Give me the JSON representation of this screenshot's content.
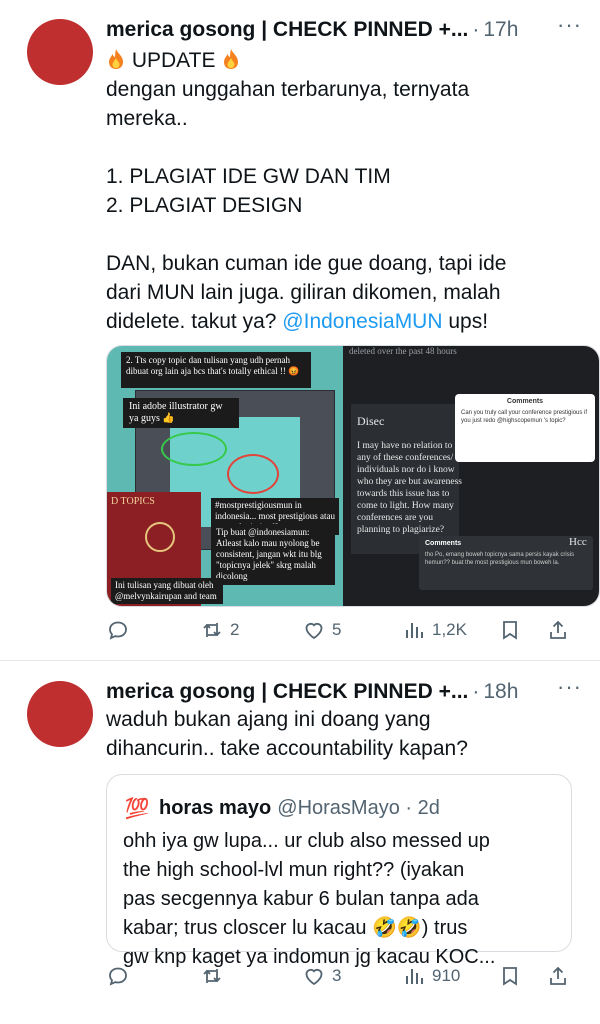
{
  "tweets": [
    {
      "display_name": "merica gosong | CHECK PINNED +...",
      "separator": "·",
      "time": "17h",
      "more": "···",
      "lines": [
        {
          "text": "UPDATE",
          "fire": true
        },
        {
          "text": "dengan unggahan terbarunya, ternyata"
        },
        {
          "text": "mereka.."
        },
        {
          "text": ""
        },
        {
          "text": "1. PLAGIAT IDE GW DAN TIM"
        },
        {
          "text": "2. PLAGIAT DESIGN"
        },
        {
          "text": ""
        },
        {
          "text": "DAN, bukan cuman ide gue doang, tapi ide"
        },
        {
          "text": "dari MUN lain juga. giliran dikomen, malah"
        },
        {
          "text_before": "didelete. takut ya? ",
          "mention": "@IndonesiaMUN",
          "text_after": " ups!"
        }
      ],
      "media": {
        "left": {
          "banner": "2. Tts copy topic dan tulisan yang udh pernah dibuat org lain aja bcs that's totally ethical !! 😡",
          "note1": "Ini adobe illustrator gw ya guys 👍",
          "red_label": "D TOPICS",
          "note2": "#mostprestigiousmun in indonesia... most prestigious atau most plagiarized?",
          "note3": "Tip buat @indonesiamun: Atleast kalo mau nyolong be consistent, jangan wkt itu blg \"topicnya jelek\" skrg malah dicolong",
          "note4": "Ini tulisan yang dibuat oleh @melvynkairupan and team"
        },
        "right": {
          "top_text": "deleted over the past 48 hours",
          "disec": "Disec",
          "body": "I may have no relation to any of these conferences/ individuals nor do i know who they are but awareness towards this issue has to come to light. How many conferences are you planning to plagiarize?",
          "card_title": "Comments",
          "card_text": "Can you truly call your conference prestigious if you just redo @highscopemun 's topic?",
          "card2_title": "Comments",
          "card2_text": "tho Po, emang boweh topicnya sama persis kayak crisis hemun?? buat the most prestigious mun boweh la.",
          "hcc": "Hcc"
        }
      },
      "actions": {
        "reply": "",
        "retweet": "2",
        "like": "5",
        "views": "1,2K"
      }
    },
    {
      "display_name": "merica gosong | CHECK PINNED +...",
      "separator": "·",
      "time": "18h",
      "more": "···",
      "lines": [
        {
          "text": "waduh bukan ajang ini doang yang"
        },
        {
          "text": "dihancurin.. take accountability kapan?"
        }
      ],
      "quote": {
        "badge": "💯",
        "name": "horas mayo",
        "handle": "@HorasMayo · 2d",
        "lines": [
          "ohh iya gw lupa... ur club also messed up",
          "the high school-lvl mun right?? (iyakan",
          "pas secgennya kabur 6 bulan tanpa ada",
          "kabar; trus closcer lu kacau 🤣🤣) trus",
          "gw knp kaget ya indomun jg kacau KOC..."
        ]
      },
      "actions": {
        "reply": "",
        "retweet": "",
        "like": "3",
        "views": "910"
      }
    }
  ],
  "colors": {
    "accent": "#1d9bf0",
    "muted": "#536471",
    "avatar": "#c02f2f"
  }
}
